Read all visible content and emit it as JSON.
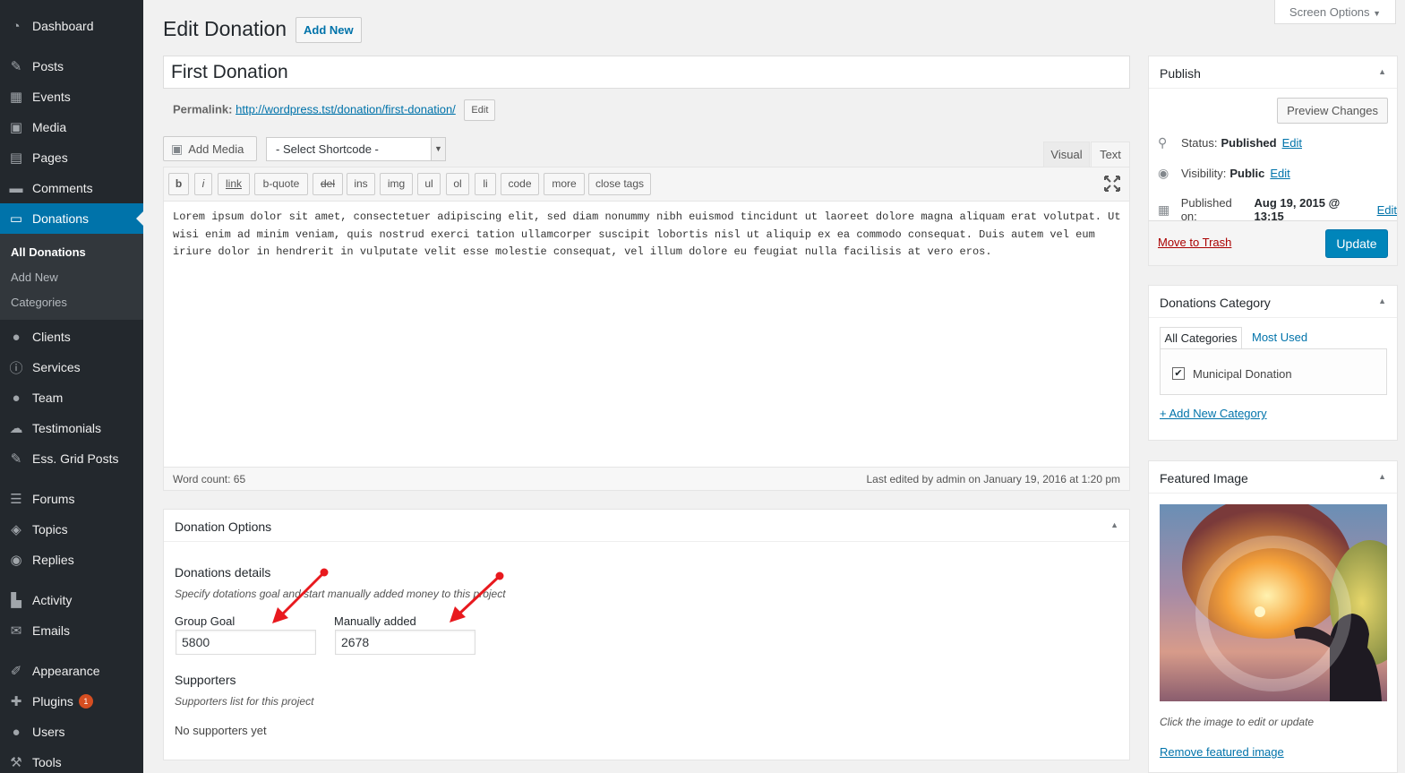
{
  "sidebar": {
    "items": [
      {
        "label": "Dashboard",
        "icon": "dashboard-icon"
      },
      {
        "label": "Posts",
        "icon": "pin-icon"
      },
      {
        "label": "Events",
        "icon": "calendar-icon"
      },
      {
        "label": "Media",
        "icon": "media-icon"
      },
      {
        "label": "Pages",
        "icon": "pages-icon"
      },
      {
        "label": "Comments",
        "icon": "comment-icon"
      },
      {
        "label": "Donations",
        "icon": "money-icon"
      },
      {
        "label": "Clients",
        "icon": "user-icon"
      },
      {
        "label": "Services",
        "icon": "info-icon"
      },
      {
        "label": "Team",
        "icon": "user-icon"
      },
      {
        "label": "Testimonials",
        "icon": "cloud-icon"
      },
      {
        "label": "Ess. Grid Posts",
        "icon": "pin-icon"
      },
      {
        "label": "Forums",
        "icon": "forum-icon"
      },
      {
        "label": "Topics",
        "icon": "topics-icon"
      },
      {
        "label": "Replies",
        "icon": "replies-icon"
      },
      {
        "label": "Activity",
        "icon": "activity-icon"
      },
      {
        "label": "Emails",
        "icon": "email-icon"
      },
      {
        "label": "Appearance",
        "icon": "brush-icon"
      },
      {
        "label": "Plugins",
        "icon": "plugin-icon",
        "badge": "1"
      },
      {
        "label": "Users",
        "icon": "user-icon"
      },
      {
        "label": "Tools",
        "icon": "wrench-icon"
      }
    ],
    "submenu": [
      "All Donations",
      "Add New",
      "Categories"
    ]
  },
  "header": {
    "screen_options": "Screen Options",
    "title": "Edit Donation",
    "add_new": "Add New"
  },
  "post": {
    "title": "First Donation",
    "permalink_label": "Permalink:",
    "permalink_url": "http://wordpress.tst/donation/first-donation/",
    "permalink_edit": "Edit"
  },
  "editor": {
    "add_media": "Add Media",
    "shortcode_select": "- Select Shortcode -",
    "tab_visual": "Visual",
    "tab_text": "Text",
    "quicktags": [
      "b",
      "i",
      "link",
      "b-quote",
      "del",
      "ins",
      "img",
      "ul",
      "ol",
      "li",
      "code",
      "more",
      "close tags"
    ],
    "content": "Lorem ipsum dolor sit amet, consectetuer adipiscing elit, sed diam nonummy nibh euismod tincidunt ut laoreet dolore magna aliquam erat volutpat. Ut wisi enim ad minim veniam, quis nostrud exerci tation ullamcorper suscipit lobortis nisl ut aliquip ex ea commodo consequat. Duis autem vel eum iriure dolor in hendrerit in vulputate velit esse molestie consequat, vel illum dolore eu feugiat nulla facilisis at vero eros.",
    "word_count": "Word count: 65",
    "last_edited": "Last edited by admin on January 19, 2016 at 1:20 pm"
  },
  "donation_options": {
    "title": "Donation Options",
    "details_heading": "Donations details",
    "details_desc": "Specify dotations goal and start manually added money to this project",
    "goal_label": "Group Goal",
    "goal_value": "5800",
    "added_label": "Manually added",
    "added_value": "2678",
    "supporters_heading": "Supporters",
    "supporters_desc": "Supporters list for this project",
    "supporters_empty": "No supporters yet"
  },
  "publish": {
    "title": "Publish",
    "preview": "Preview Changes",
    "status_label": "Status:",
    "status_value": "Published",
    "visibility_label": "Visibility:",
    "visibility_value": "Public",
    "published_label": "Published on:",
    "published_value": "Aug 19, 2015 @ 13:15",
    "edit": "Edit",
    "trash": "Move to Trash",
    "update": "Update"
  },
  "category": {
    "title": "Donations Category",
    "tab_all": "All Categories",
    "tab_most": "Most Used",
    "items": [
      {
        "label": "Municipal Donation",
        "checked": true
      }
    ],
    "add_new": "+ Add New Category"
  },
  "featured": {
    "title": "Featured Image",
    "caption": "Click the image to edit or update",
    "remove": "Remove featured image"
  },
  "colors": {
    "sidebar_bg": "#23282d",
    "accent": "#0073aa",
    "primary_button": "#0085ba",
    "trash": "#a00000",
    "annotation_arrow": "#e8191e"
  }
}
